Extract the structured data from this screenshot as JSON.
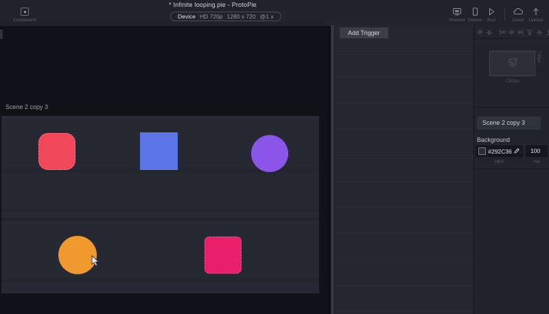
{
  "titlebar": {
    "title": "* Infinite looping.pie - ProtoPie"
  },
  "toolbar": {
    "component_label": "Component",
    "device_pill": {
      "device_label": "Device",
      "preset": "HD 720p",
      "resolution": "1280 x 720",
      "scale": "@1 x"
    },
    "actions": [
      {
        "icon": "preview-monitor-icon",
        "label": "Preview"
      },
      {
        "icon": "device-phone-icon",
        "label": "Device"
      },
      {
        "icon": "run-play-icon",
        "label": "Run"
      },
      {
        "icon": "cloud-icon",
        "label": "Cloud"
      },
      {
        "icon": "upload-arrow-icon",
        "label": "Upload"
      }
    ]
  },
  "canvas": {
    "scene_label": "Scene 2 copy 3",
    "background_hex": "#292C36",
    "shapes": [
      {
        "name": "red-rounded-square",
        "type": "rounded-square",
        "color": "#F2485C"
      },
      {
        "name": "blue-square",
        "type": "square",
        "color": "#5A74E8"
      },
      {
        "name": "purple-circle",
        "type": "circle",
        "color": "#8B55E9"
      },
      {
        "name": "orange-circle",
        "type": "circle",
        "color": "#F0992F"
      },
      {
        "name": "pink-rounded-square",
        "type": "rounded-square",
        "color": "#E72069"
      }
    ]
  },
  "trigger_panel": {
    "add_trigger_label": "Add Trigger"
  },
  "properties": {
    "align_icons": [
      "align-horizontal-center-icon",
      "align-vertical-center-icon",
      "align-left-icon",
      "align-center-icon",
      "align-right-icon",
      "align-top-icon",
      "align-middle-icon",
      "align-bottom-icon"
    ],
    "device_preview": {
      "width_label": "1280px",
      "height_label": "720px"
    },
    "scene_name": "Scene 2 copy 3",
    "background_section": {
      "label": "Background",
      "hex_value": "#292C36",
      "hex_label": "HEX",
      "fill_value": "100",
      "fill_label": "Fill"
    }
  }
}
